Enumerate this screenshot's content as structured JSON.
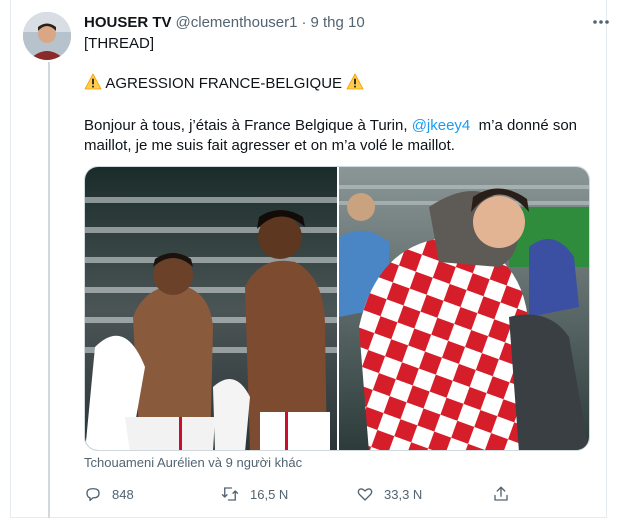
{
  "tweet": {
    "author_name": "HOUSER TV",
    "handle": "@clementhouser1",
    "separator": "·",
    "time": "9 thg 10",
    "thread_label": "[THREAD]",
    "headline": "AGRESSION FRANCE-BELGIQUE",
    "body_line1_before": "Bonjour à tous, j’étais à France Belgique à Turin, ",
    "mention": "@jkeey4",
    "body_line1_after": "  m’a donné son",
    "body_line2": "maillot, je me suis fait agresser et on m’a volé le maillot.",
    "tagged_people": "Tchouameni Aurélien và 9 người khác"
  },
  "actions": {
    "reply_count": "848",
    "retweet_count": "16,5 N",
    "like_count": "33,3 N"
  },
  "icons": {
    "more": "more-icon",
    "warning": "warning-icon",
    "reply": "reply-icon",
    "retweet": "retweet-icon",
    "like": "like-icon",
    "share": "share-icon"
  },
  "colors": {
    "text": "#0f1419",
    "secondary": "#536471",
    "link": "#1d9bf0",
    "border": "#cfd9de"
  }
}
